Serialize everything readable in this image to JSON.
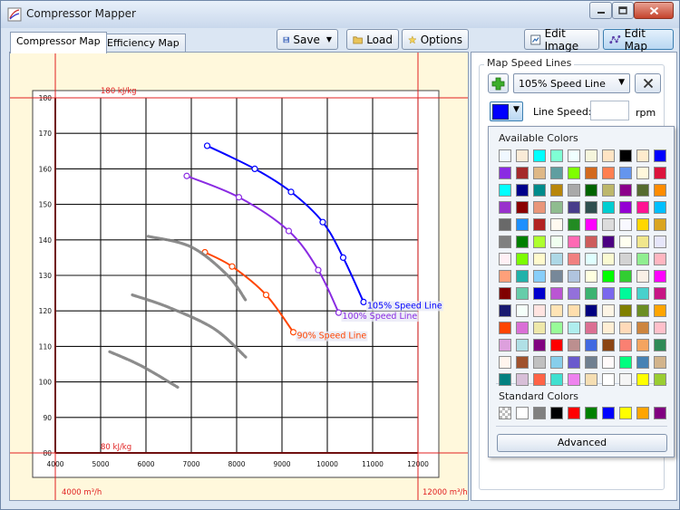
{
  "window": {
    "title": "Compressor Mapper",
    "icons": {
      "app": "compressor-map-icon",
      "minimize": "minimize-icon",
      "maximize": "maximize-icon",
      "close": "close-icon"
    }
  },
  "tabs": [
    {
      "label": "Compressor Map",
      "selected": true
    },
    {
      "label": "Efficiency Map",
      "selected": false
    }
  ],
  "toolbar": {
    "save_label": "Save",
    "load_label": "Load",
    "options_label": "Options",
    "edit_image_label": "Edit Image",
    "edit_map_label": "Edit Map",
    "edit_map_active": true,
    "icons": {
      "save": "floppy-disk-icon",
      "load": "folder-icon",
      "options": "star-icon",
      "edit_image": "image-edit-icon",
      "edit_map": "map-nodes-icon"
    }
  },
  "speed_lines_panel": {
    "title": "Map Speed Lines",
    "selected_line": "105% Speed Line",
    "line_speed_label": "Line Speed:",
    "line_speed_value": "",
    "rpm_label": "rpm",
    "selected_color": "#0000FF",
    "icons": {
      "add": "plus-icon",
      "delete": "x-icon",
      "dropdown": "chevron-down-icon"
    }
  },
  "color_popup": {
    "available_label": "Available Colors",
    "standard_label": "Standard Colors",
    "advanced_label": "Advanced",
    "available_colors": [
      "#F0F8FF",
      "#FAEBD7",
      "#00FFFF",
      "#7FFFD4",
      "#F0FFFF",
      "#F5F5DC",
      "#FFE4C4",
      "#000000",
      "#FFEBCD",
      "#0000FF",
      "#8A2BE2",
      "#A52A2A",
      "#DEB887",
      "#5F9EA0",
      "#7FFF00",
      "#D2691E",
      "#FF7F50",
      "#6495ED",
      "#FFF8DC",
      "#DC143C",
      "#00FFFF",
      "#00008B",
      "#008B8B",
      "#B8860B",
      "#A9A9A9",
      "#006400",
      "#BDB76B",
      "#8B008B",
      "#556B2F",
      "#FF8C00",
      "#9932CC",
      "#8B0000",
      "#E9967A",
      "#8FBC8F",
      "#483D8B",
      "#2F4F4F",
      "#00CED1",
      "#9400D3",
      "#FF1493",
      "#00BFFF",
      "#696969",
      "#1E90FF",
      "#B22222",
      "#FFFAF0",
      "#228B22",
      "#FF00FF",
      "#DCDCDC",
      "#F8F8FF",
      "#FFD700",
      "#DAA520",
      "#808080",
      "#008000",
      "#ADFF2F",
      "#F0FFF0",
      "#FF69B4",
      "#CD5C5C",
      "#4B0082",
      "#FFFFF0",
      "#F0E68C",
      "#E6E6FA",
      "#FFF0F5",
      "#7CFC00",
      "#FFFACD",
      "#ADD8E6",
      "#F08080",
      "#E0FFFF",
      "#FAFAD2",
      "#D3D3D3",
      "#90EE90",
      "#FFB6C1",
      "#FFA07A",
      "#20B2AA",
      "#87CEFA",
      "#778899",
      "#B0C4DE",
      "#FFFFE0",
      "#00FF00",
      "#32CD32",
      "#FAF0E6",
      "#FF00FF",
      "#800000",
      "#66CDAA",
      "#0000CD",
      "#BA55D3",
      "#9370DB",
      "#3CB371",
      "#7B68EE",
      "#00FA9A",
      "#48D1CC",
      "#C71585",
      "#191970",
      "#F5FFFA",
      "#FFE4E1",
      "#FFE4B5",
      "#FFDEAD",
      "#000080",
      "#FDF5E6",
      "#808000",
      "#6B8E23",
      "#FFA500",
      "#FF4500",
      "#DA70D6",
      "#EEE8AA",
      "#98FB98",
      "#AFEEEE",
      "#DB7093",
      "#FFEFD5",
      "#FFDAB9",
      "#CD853F",
      "#FFC0CB",
      "#DDA0DD",
      "#B0E0E6",
      "#800080",
      "#FF0000",
      "#BC8F8F",
      "#4169E1",
      "#8B4513",
      "#FA8072",
      "#F4A460",
      "#2E8B57",
      "#FFF5EE",
      "#A0522D",
      "#C0C0C0",
      "#87CEEB",
      "#6A5ACD",
      "#708090",
      "#FFFAFA",
      "#00FF7F",
      "#4682B4",
      "#D2B48C",
      "#008080",
      "#D8BFD8",
      "#FF6347",
      "#40E0D0",
      "#EE82EE",
      "#F5DEB3",
      "#FFFFFF",
      "#F5F5F5",
      "#FFFF00",
      "#9ACD32"
    ],
    "standard_colors": [
      "transparent",
      "#FFFFFF",
      "#808080",
      "#000000",
      "#FF0000",
      "#008000",
      "#0000FF",
      "#FFFF00",
      "#FFA500",
      "#800080"
    ]
  },
  "map": {
    "background_color": "#FFF8DC",
    "x_axis": {
      "ticks": [
        4000,
        5000,
        6000,
        7000,
        8000,
        9000,
        10000,
        11000,
        12000
      ],
      "min": 4000,
      "max": 12000,
      "tick_labels": [
        "4000",
        "5000",
        "6000",
        "7000",
        "8000",
        "9000",
        "10000",
        "11000",
        "12000"
      ]
    },
    "y_axis": {
      "ticks": [
        80,
        90,
        100,
        110,
        120,
        130,
        140,
        150,
        160,
        170,
        180
      ],
      "min": 80,
      "max": 180,
      "tick_labels": [
        "80",
        "90",
        "100",
        "110",
        "120",
        "130",
        "140",
        "150",
        "160",
        "170",
        "180"
      ]
    },
    "calibration": {
      "top_label": "180 kJ/kg",
      "bottom_label": "80 kJ/kg",
      "left_label": "4000 m³/h",
      "right_label": "12000 m³/h"
    }
  },
  "chart_data": {
    "type": "line",
    "title": "",
    "xlabel": "",
    "ylabel": "",
    "xlim": [
      4000,
      12000
    ],
    "ylim": [
      80,
      180
    ],
    "grid": true,
    "series": [
      {
        "name": "105% Speed Line",
        "color": "#0000FF",
        "points": [
          [
            7350,
            166.5
          ],
          [
            8400,
            160
          ],
          [
            9200,
            153.5
          ],
          [
            9900,
            145
          ],
          [
            10350,
            135
          ],
          [
            10800,
            122.5
          ]
        ]
      },
      {
        "name": "100% Speed Line",
        "color": "#8A2BE2",
        "points": [
          [
            6900,
            158
          ],
          [
            8050,
            152
          ],
          [
            9150,
            142.5
          ],
          [
            9800,
            131.5
          ],
          [
            10250,
            119.5
          ]
        ]
      },
      {
        "name": "90% Speed Line",
        "color": "#FF4500",
        "points": [
          [
            7300,
            136.5
          ],
          [
            7900,
            132.5
          ],
          [
            8650,
            124.5
          ],
          [
            9250,
            114
          ]
        ]
      },
      {
        "name": "",
        "color": "#808080",
        "points": [
          [
            6050,
            141
          ],
          [
            7000,
            138
          ],
          [
            7800,
            130
          ],
          [
            8200,
            123
          ]
        ]
      },
      {
        "name": "",
        "color": "#808080",
        "points": [
          [
            5700,
            124.5
          ],
          [
            6500,
            121
          ],
          [
            7500,
            115
          ],
          [
            8200,
            107
          ]
        ]
      },
      {
        "name": "",
        "color": "#808080",
        "points": [
          [
            5200,
            108.5
          ],
          [
            5900,
            104.5
          ],
          [
            6700,
            98.5
          ]
        ]
      }
    ]
  }
}
